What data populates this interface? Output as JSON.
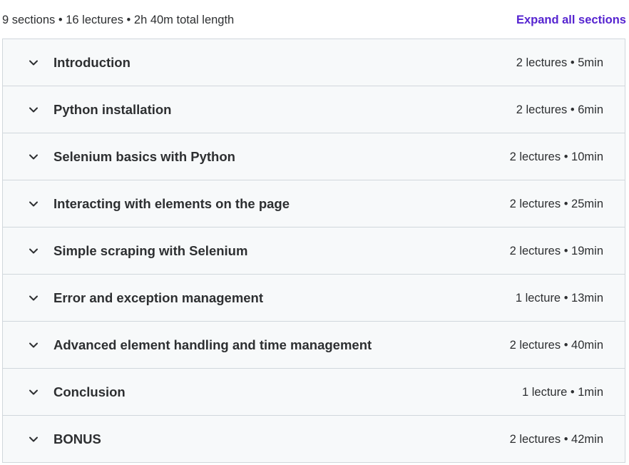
{
  "summary": {
    "text": "9 sections • 16 lectures • 2h 40m total length",
    "expand_all_label": "Expand all sections"
  },
  "icons": {
    "section_toggle": "chevron-down-icon"
  },
  "colors": {
    "accent": "#5624d0",
    "row_background": "#f7f9fa",
    "border": "#d1d7dc",
    "text": "#2d2f31"
  },
  "sections": [
    {
      "title": "Introduction",
      "meta": "2 lectures • 5min"
    },
    {
      "title": "Python installation",
      "meta": "2 lectures • 6min"
    },
    {
      "title": "Selenium basics with Python",
      "meta": "2 lectures • 10min"
    },
    {
      "title": "Interacting with elements on the page",
      "meta": "2 lectures • 25min"
    },
    {
      "title": "Simple scraping with Selenium",
      "meta": "2 lectures • 19min"
    },
    {
      "title": "Error and exception management",
      "meta": "1 lecture • 13min"
    },
    {
      "title": "Advanced element handling and time management",
      "meta": "2 lectures • 40min"
    },
    {
      "title": "Conclusion",
      "meta": "1 lecture • 1min"
    },
    {
      "title": "BONUS",
      "meta": "2 lectures • 42min"
    }
  ]
}
